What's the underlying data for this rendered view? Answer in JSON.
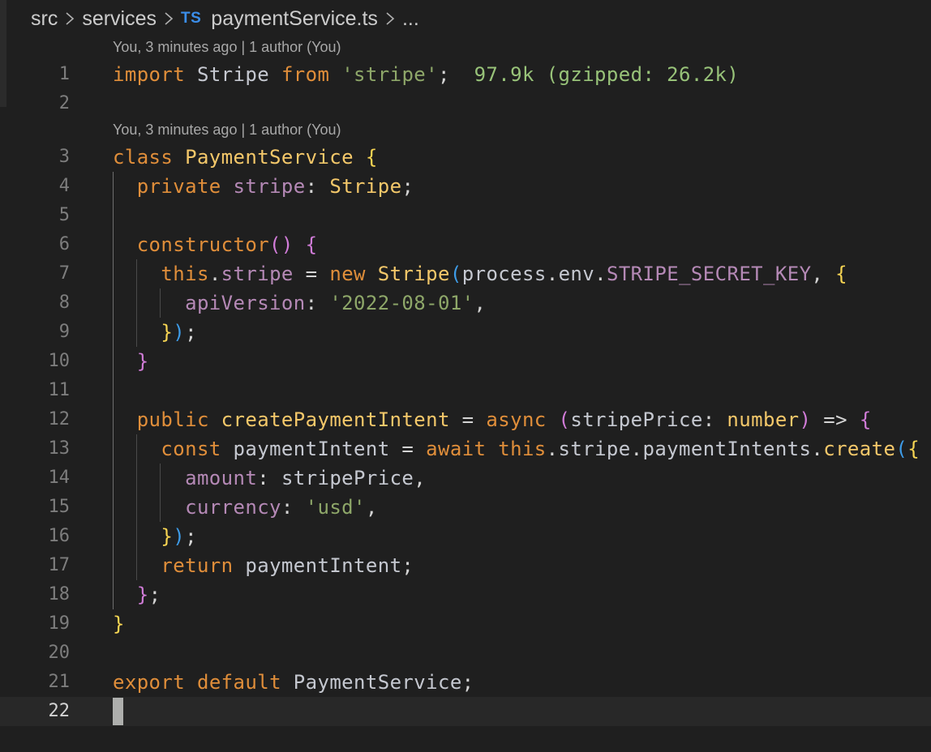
{
  "breadcrumb": {
    "folder1": "src",
    "folder2": "services",
    "file_badge": "TS",
    "file": "paymentService.ts",
    "more": "..."
  },
  "blame": {
    "b1": "You, 3 minutes ago | 1 author (You)",
    "b2": "You, 3 minutes ago | 1 author (You)"
  },
  "import_cost": "97.9k (gzipped: 26.2k)",
  "line_numbers": [
    "1",
    "2",
    "3",
    "4",
    "5",
    "6",
    "7",
    "8",
    "9",
    "10",
    "11",
    "12",
    "13",
    "14",
    "15",
    "16",
    "17",
    "18",
    "19",
    "20",
    "21",
    "22"
  ],
  "tokens": {
    "l1": [
      "import",
      "Stripe",
      "from",
      "'stripe'",
      ";"
    ],
    "l3": [
      "class",
      "PaymentService",
      "{"
    ],
    "l4": [
      "private",
      "stripe",
      ":",
      "Stripe",
      ";"
    ],
    "l6": [
      "constructor",
      "()",
      "{"
    ],
    "l7": [
      "this",
      ".",
      "stripe",
      "=",
      "new",
      "Stripe",
      "(",
      "process",
      ".",
      "env",
      ".",
      "STRIPE_SECRET_KEY",
      ",",
      "{"
    ],
    "l8": [
      "apiVersion",
      ":",
      "'2022-08-01'",
      ","
    ],
    "l9": [
      "}",
      ")",
      ";"
    ],
    "l10": [
      "}"
    ],
    "l12": [
      "public",
      "createPaymentIntent",
      "=",
      "async",
      "(",
      "stripePrice",
      ":",
      "number",
      ")",
      "=>",
      "{"
    ],
    "l13": [
      "const",
      "paymentIntent",
      "=",
      "await",
      "this",
      ".",
      "stripe",
      ".",
      "paymentIntents",
      ".",
      "create",
      "(",
      "{"
    ],
    "l14": [
      "amount",
      ":",
      "stripePrice",
      ","
    ],
    "l15": [
      "currency",
      ":",
      "'usd'",
      ","
    ],
    "l16": [
      "}",
      ")",
      ";"
    ],
    "l17": [
      "return",
      "paymentIntent",
      ";"
    ],
    "l18": [
      "}",
      ";"
    ],
    "l19": [
      "}"
    ],
    "l21": [
      "export",
      "default",
      "PaymentService",
      ";"
    ]
  }
}
